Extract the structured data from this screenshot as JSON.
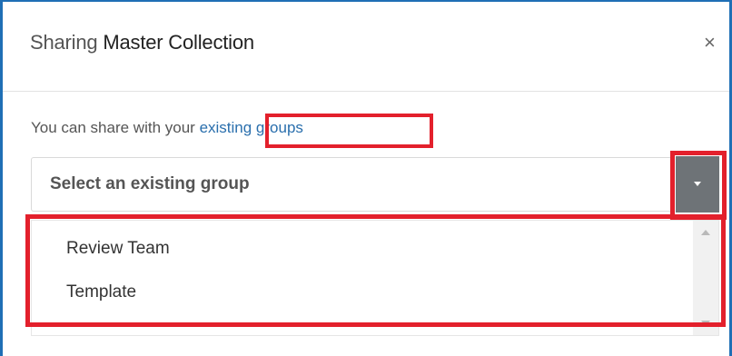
{
  "dialog": {
    "title_prefix": "Sharing",
    "title_collection": "Master Collection",
    "close_glyph": "×"
  },
  "intro": {
    "text": "You can share with your",
    "link": "existing groups"
  },
  "select": {
    "placeholder": "Select an existing group"
  },
  "dropdown": {
    "options": [
      "Review Team",
      "Template"
    ]
  },
  "colors": {
    "highlight": "#e3202c",
    "link": "#2a6fad",
    "toggle": "#6e7377"
  }
}
